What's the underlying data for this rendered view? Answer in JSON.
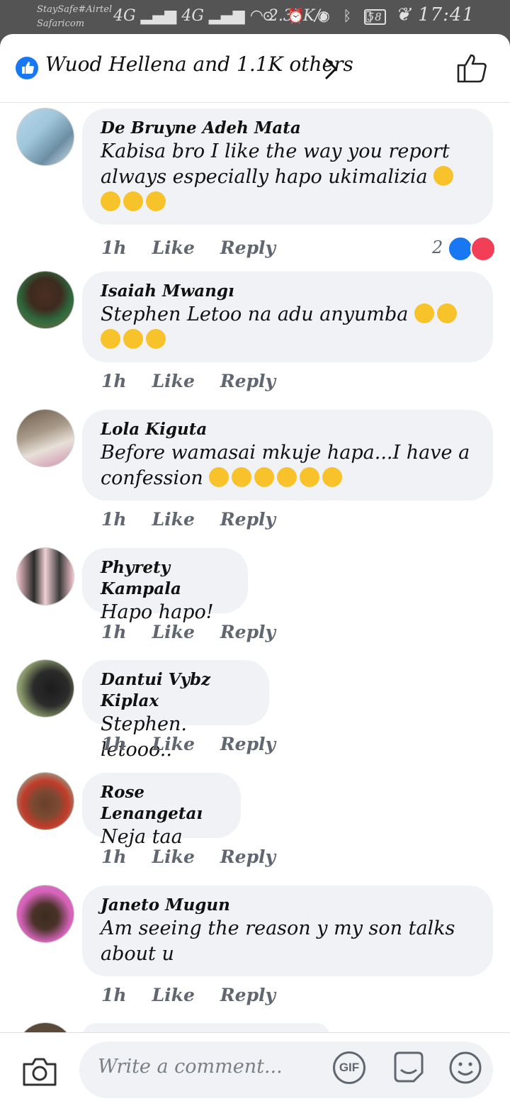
{
  "status_bar": {
    "carrier_1": "StaySafe#Airtel",
    "carrier_2": "Safaricom",
    "network": "4G",
    "speed": "2.31K/s",
    "battery": "58",
    "time": "17:41"
  },
  "header": {
    "reactors": "Wuod Hellena and 1.1K others"
  },
  "comments": [
    {
      "author": "De Bruyne Adeh Mata",
      "text": "Kabisa bro I like the way you report always especially hapo ukimalizia",
      "emojis": [
        "rolling-laughing",
        "rolling-laughing",
        "rolling-laughing",
        "rolling-laughing"
      ],
      "time": "1h",
      "like": "Like",
      "reply": "Reply",
      "reaction_count": "2",
      "reactions": [
        "like",
        "love"
      ]
    },
    {
      "author": "Isaiah Mwangı",
      "text": "Stephen Letoo na adu anyumba",
      "emojis": [
        "tears-of-joy",
        "tears-of-joy",
        "tears-of-joy",
        "tears-of-joy",
        "tears-of-joy"
      ],
      "time": "1h",
      "like": "Like",
      "reply": "Reply"
    },
    {
      "author": "Lola Kiguta",
      "text": "Before wamasai mkuje hapa...I have a confession",
      "emojis": [
        "sad",
        "sad",
        "sad",
        "raised-eyebrow",
        "kissing",
        "eye-roll"
      ],
      "time": "1h",
      "like": "Like",
      "reply": "Reply"
    },
    {
      "author": "Phyrety Kampala",
      "text": "Hapo hapo!",
      "time": "1h",
      "like": "Like",
      "reply": "Reply"
    },
    {
      "author": "Dantui Vybz Kiplax",
      "text": "Stephen. letooo..",
      "time": "1h",
      "like": "Like",
      "reply": "Reply"
    },
    {
      "author": "Rose Lenangetaı",
      "text": "Neja taa",
      "time": "1h",
      "like": "Like",
      "reply": "Reply"
    },
    {
      "author": "Janeto Mugun",
      "text": "Am seeing the reason y my son talks about u",
      "time": "1h",
      "like": "Like",
      "reply": "Reply"
    }
  ],
  "composer": {
    "placeholder": "Write a comment...",
    "gif_label": "GIF"
  },
  "colors": {
    "accent": "#1877f2",
    "love": "#f33e58",
    "bubble": "#f0f2f5",
    "muted": "#606770"
  }
}
